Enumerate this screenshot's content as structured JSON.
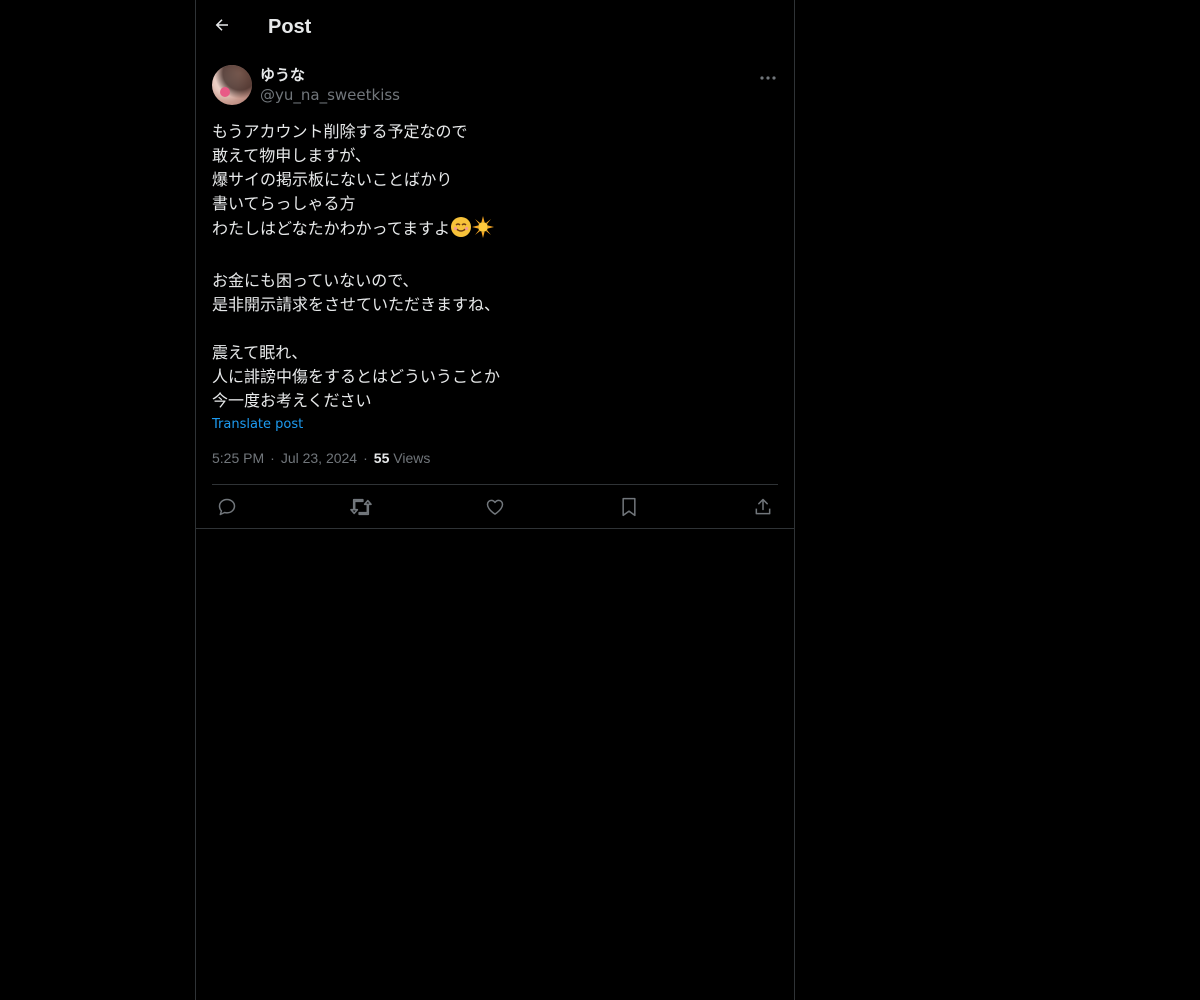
{
  "header": {
    "title": "Post"
  },
  "post": {
    "author": {
      "display_name": "ゆうな",
      "handle": "@yu_na_sweetkiss"
    },
    "lines": [
      "もうアカウント削除する予定なので",
      "敢えて物申しますが、",
      "爆サイの掲示板にないことばかり",
      "書いてらっしゃる方",
      "わたしはどなたかわかってますよ",
      "",
      "お金にも困っていないので、",
      "是非開示請求をさせていただきますね、",
      "",
      "震えて眠れ、",
      "人に誹謗中傷をするとはどういうことか",
      "今一度お考えください"
    ],
    "emojis": [
      "smiling-face-emoji",
      "sun-emoji"
    ],
    "translate_label": "Translate post",
    "time": "5:25 PM",
    "date": "Jul 23, 2024",
    "views_count": "55",
    "views_label": "Views"
  },
  "colors": {
    "background": "#000000",
    "text": "#e7e9ea",
    "secondary": "#71767b",
    "accent": "#1d9bf0",
    "border": "#2f3336"
  },
  "icons": [
    "arrow-left-icon",
    "more-icon",
    "reply-icon",
    "repost-icon",
    "like-icon",
    "bookmark-icon",
    "share-icon"
  ]
}
